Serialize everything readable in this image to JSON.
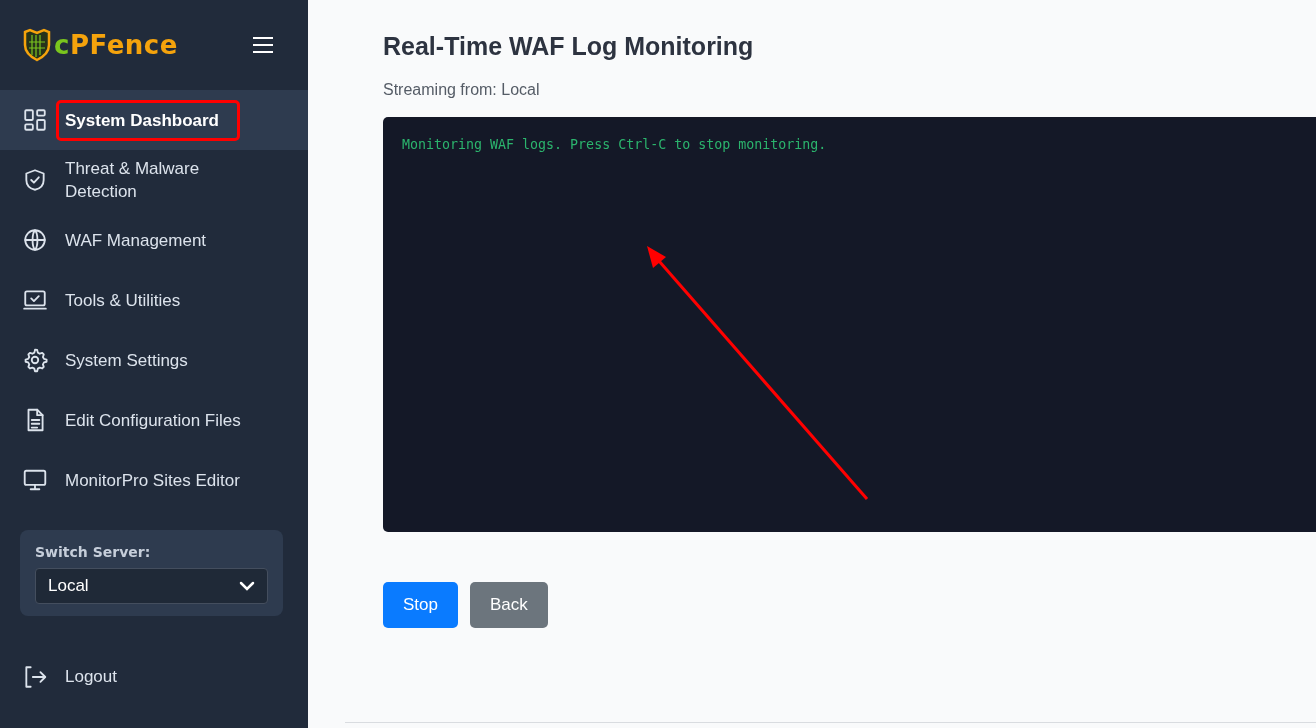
{
  "sidebar": {
    "logo": "cPFence",
    "items": [
      {
        "label": "System Dashboard",
        "selected": true,
        "highlighted": true
      },
      {
        "label": "Threat & Malware Detection",
        "selected": false,
        "highlighted": false
      },
      {
        "label": "WAF Management",
        "selected": false,
        "highlighted": false
      },
      {
        "label": "Tools & Utilities",
        "selected": false,
        "highlighted": false
      },
      {
        "label": "System Settings",
        "selected": false,
        "highlighted": false
      },
      {
        "label": "Edit Configuration Files",
        "selected": false,
        "highlighted": false
      },
      {
        "label": "MonitorPro Sites Editor",
        "selected": false,
        "highlighted": false
      }
    ],
    "server_switch": {
      "label": "Switch Server:",
      "value": "Local"
    },
    "logout": "Logout"
  },
  "main": {
    "title": "Real-Time WAF Log Monitoring",
    "subtitle": "Streaming from: Local",
    "console_lines": [
      "Monitoring WAF logs. Press Ctrl-C to stop monitoring."
    ],
    "annotation_arrow": true,
    "buttons": [
      {
        "label": "Stop",
        "kind": "primary"
      },
      {
        "label": "Back",
        "kind": "secondary"
      }
    ]
  }
}
